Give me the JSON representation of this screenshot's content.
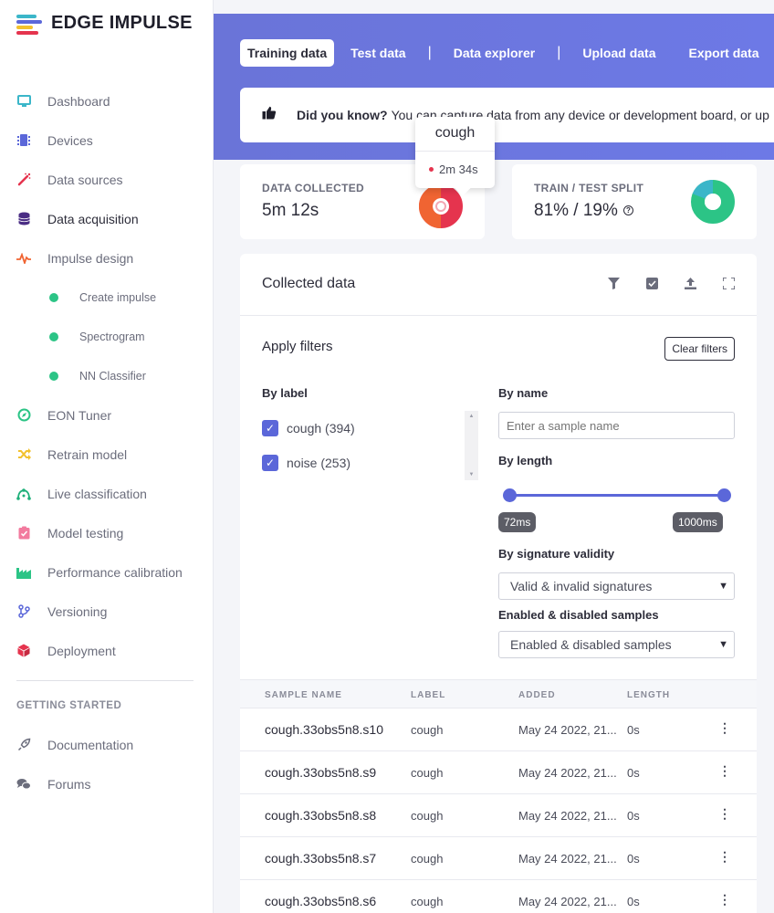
{
  "brand": {
    "name": "EDGE IMPULSE"
  },
  "sidebar": {
    "items": [
      {
        "label": "Dashboard",
        "icon": "monitor-icon",
        "color": "#3bb6c9"
      },
      {
        "label": "Devices",
        "icon": "chip-icon",
        "color": "#5b67d9"
      },
      {
        "label": "Data sources",
        "icon": "wand-icon",
        "color": "#e5344e"
      },
      {
        "label": "Data acquisition",
        "icon": "database-icon",
        "color": "#4a2d84"
      },
      {
        "label": "Impulse design",
        "icon": "pulse-icon",
        "color": "#f06432"
      }
    ],
    "sub_items": [
      {
        "label": "Create impulse"
      },
      {
        "label": "Spectrogram"
      },
      {
        "label": "NN Classifier"
      }
    ],
    "items_after": [
      {
        "label": "EON Tuner",
        "icon": "compass-icon",
        "color": "#2cc486"
      },
      {
        "label": "Retrain model",
        "icon": "shuffle-icon",
        "color": "#f2c12e"
      },
      {
        "label": "Live classification",
        "icon": "network-icon",
        "color": "#1fb07a"
      },
      {
        "label": "Model testing",
        "icon": "clipboard-check-icon",
        "color": "#f27a9e"
      },
      {
        "label": "Performance calibration",
        "icon": "factory-icon",
        "color": "#2cc486"
      },
      {
        "label": "Versioning",
        "icon": "branch-icon",
        "color": "#5b67d9"
      },
      {
        "label": "Deployment",
        "icon": "cube-icon",
        "color": "#e5344e"
      }
    ],
    "section_title": "GETTING STARTED",
    "getting_started": [
      {
        "label": "Documentation",
        "icon": "rocket-icon"
      },
      {
        "label": "Forums",
        "icon": "chat-icon"
      }
    ]
  },
  "tabs": {
    "training": "Training data",
    "test": "Test data",
    "explorer": "Data explorer",
    "upload": "Upload data",
    "export": "Export data",
    "separator": "|"
  },
  "info": {
    "bold": "Did you know?",
    "text": "You can capture data from any device or development board, or up"
  },
  "stats": {
    "collected_label": "DATA COLLECTED",
    "collected_value": "5m 12s",
    "split_label": "TRAIN / TEST SPLIT",
    "split_value": "81% / 19%",
    "help": "?"
  },
  "tooltip": {
    "title": "cough",
    "value": "2m 34s"
  },
  "collected": {
    "title": "Collected data",
    "filters_title": "Apply filters",
    "clear_filters": "Clear filters",
    "by_label": "By label",
    "labels": [
      {
        "text": "cough (394)",
        "checked": true
      },
      {
        "text": "noise (253)",
        "checked": true
      }
    ],
    "by_name": "By name",
    "name_placeholder": "Enter a sample name",
    "by_length": "By length",
    "length_min": "72ms",
    "length_max": "1000ms",
    "by_signature": "By signature validity",
    "signature_value": "Valid & invalid signatures",
    "enabled_title": "Enabled & disabled samples",
    "enabled_value": "Enabled & disabled samples"
  },
  "table": {
    "headers": [
      "SAMPLE NAME",
      "LABEL",
      "ADDED",
      "LENGTH"
    ],
    "rows": [
      {
        "name": "cough.33obs5n8.s10",
        "label": "cough",
        "added": "May 24 2022, 21...",
        "length": "0s"
      },
      {
        "name": "cough.33obs5n8.s9",
        "label": "cough",
        "added": "May 24 2022, 21...",
        "length": "0s"
      },
      {
        "name": "cough.33obs5n8.s8",
        "label": "cough",
        "added": "May 24 2022, 21...",
        "length": "0s"
      },
      {
        "name": "cough.33obs5n8.s7",
        "label": "cough",
        "added": "May 24 2022, 21...",
        "length": "0s"
      },
      {
        "name": "cough.33obs5n8.s6",
        "label": "cough",
        "added": "May 24 2022, 21...",
        "length": "0s"
      }
    ]
  },
  "colors": {
    "accent": "#5b67d9",
    "header_band": "#6a74d8",
    "donut_collected": [
      "#f06432",
      "#e5344e"
    ],
    "donut_split": [
      "#2cc486",
      "#3bb6c9"
    ]
  }
}
